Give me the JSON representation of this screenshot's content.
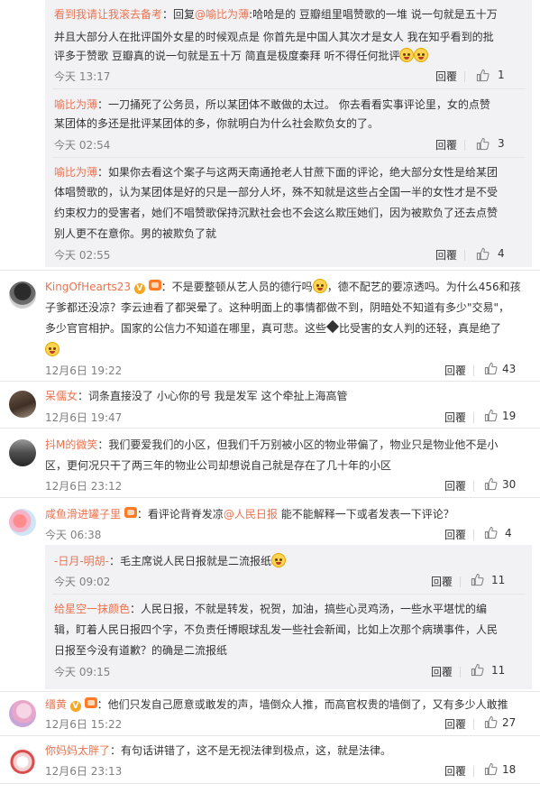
{
  "reply_label": "回覆",
  "colors": {
    "name": "#eb7350",
    "text": "#333333",
    "meta": "#808080",
    "panel": "#f2f2f5"
  },
  "c1": {
    "name": "看到我请让我滚去备考",
    "line1": "：回复",
    "mention": "@喻比为薄",
    "line1b": ":哈哈是的 豆瓣组里唱赞歌的一堆 说一句就是五十万",
    "line2": "并且大部分人在批评国外女星的时候观点是 你首先是中国人其次才是女人 我在知乎看到的批",
    "line3": "评多于赞歌 豆瓣真的说一句就是五十万 简直是极度秦拜 听不得任何批评",
    "time": "今天 13:17",
    "likes": "1"
  },
  "c2": {
    "name": "喻比为薄",
    "line1": "：一刀捅死了公务员，所以某团体不敢做的太过。  你去看看实事评论里，女的点赞",
    "line2": "某团体的多还是批评某团体的多，你就明白为什么社会欺负女的了。",
    "time": "今天 02:54",
    "likes": "3"
  },
  "c3": {
    "name": "喻比为薄",
    "line1": "：如果你去看这个案子与这两天南通抢老人甘蔗下面的评论，绝大部分女性是给某团",
    "line2": "体唱赞歌的，认为某团体是好的只是一部分人坏，殊不知就是这些占全国一半的女性才是不受",
    "line3": "约束权力的受害者，她们不唱赞歌保持沉默社会也不会这么欺压她们，因为被欺负了还去点赞",
    "line4": "别人更不在意你。男的被欺负了就",
    "time": "今天 02:55",
    "likes": "4"
  },
  "c4": {
    "name": "KingOfHearts23",
    "line1a": "：不是要整顿从艺人员的德行吗",
    "line1b": "，德不配艺的要凉透吗。为什么456和孩",
    "line2": "子爹都还没凉？李云迪看了都哭晕了。这种明面上的事情都做不到，阴暗处不知道有多少\"交易\"，",
    "line3a": "多少官官相护。国家的公信力不知道在哪里，真可悲。这些",
    "line3b": "比受害的女人判的还轻，真是绝了",
    "time": "12月6日 19:22",
    "likes": "43"
  },
  "c5": {
    "name": "呆儒女",
    "line1": "：词条直接没了  小心你的号  我是发军   这个牵扯上海高管",
    "time": "12月6日 19:47",
    "likes": "19"
  },
  "c6": {
    "name": "抖M的微笑",
    "line1": "：我们要爱我们的小区，但我们千万别被小区的物业带偏了，物业只是物业他不是小",
    "line2": "区，更何况只干了两三年的物业公司却想说自己就是存在了几十年的小区",
    "time": "12月6日 23:12",
    "likes": "30"
  },
  "c7": {
    "name": "咸鱼滑进罐子里",
    "line1a": "：看评论背脊发凉",
    "mention": "@人民日报",
    "line1b": " 能不能解释一下或者发表一下评论？",
    "time": "今天 06:38",
    "likes": "4"
  },
  "c8": {
    "name": "-日月-明胡-",
    "line1": "：毛主席说人民日报就是二流报纸",
    "time": "今天 09:02",
    "likes": "11"
  },
  "c9": {
    "name": "给星空一抹颜色",
    "line1": "：人民日报，不就是转发，祝贺，加油，搞些心灵鸡汤，一些水平堪忧的编",
    "line2": "辑，盯着人民日报四个字，不负责任博眼球乱发一些社会新闻，比如上次那个病璜事件，人民",
    "line3": "日报至今没有道歉？的确是二流报纸",
    "time": "今天 09:15",
    "likes": "11"
  },
  "c10": {
    "name": "缙黄",
    "line1": "：他们只发自己愿意或敢发的声，墙倒众人推，而高官权贵的墙倒了，又有多少人敢推",
    "time": "12月6日 15:22",
    "likes": "27"
  },
  "c11": {
    "name": "你妈妈太胖了",
    "line1": "：有句话讲错了，这不是无视法律到极点，这，就是法律。",
    "time": "12月6日 23:13",
    "likes": "18"
  }
}
